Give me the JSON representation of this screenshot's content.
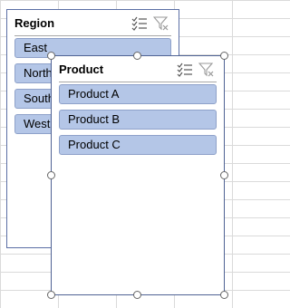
{
  "slicers": [
    {
      "id": "region",
      "title": "Region",
      "items": [
        "East",
        "North",
        "South",
        "West"
      ]
    },
    {
      "id": "product",
      "title": "Product",
      "items": [
        "Product A",
        "Product B",
        "Product C"
      ]
    }
  ],
  "icons": {
    "multi_select": "multi-select-icon",
    "clear_filter": "clear-filter-icon"
  },
  "colors": {
    "item_fill": "#b4c6e7",
    "item_border": "#8ea1c9",
    "slicer_border": "#5b6fa5",
    "grid_line": "#dadada"
  }
}
